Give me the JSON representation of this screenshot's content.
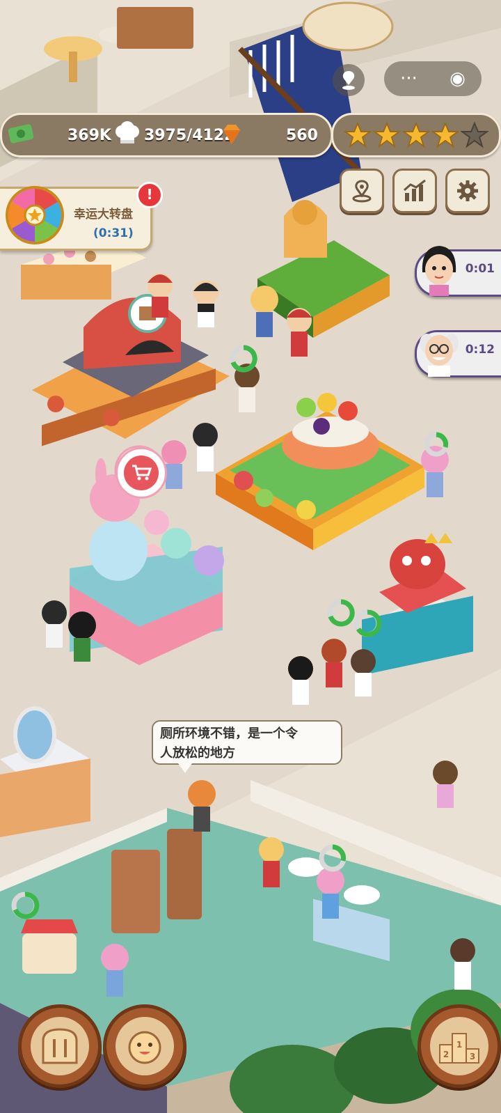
{
  "hud": {
    "cash_value": "369K",
    "chefs_value": "3975/4122",
    "gems_value": "560",
    "rating_stars_filled": 4,
    "rating_stars_total": 5
  },
  "lucky_wheel": {
    "title": "幸运大转盘",
    "timer": "(0:31)",
    "badge": "!"
  },
  "staff_timers": [
    {
      "icon": "receptionist-avatar-icon",
      "time": "0:01"
    },
    {
      "icon": "scientist-avatar-icon",
      "time": "0:12"
    }
  ],
  "speech_bubble": {
    "text_line1": "厕所环境不错，是一个令",
    "text_line2": "人放松的地方"
  },
  "bottom_buttons": {
    "menu_icon": "menu-bread-icon",
    "staff_icon": "chef-face-icon",
    "ranking_icon": "podium-icon"
  },
  "podium": {
    "ranks": [
      "2",
      "1",
      "3"
    ]
  },
  "colors": {
    "hud_bg": "#8a7a64",
    "star_gold": "#f5b82e",
    "star_empty": "#6b6256",
    "alert_red": "#e8373c",
    "timer_blue": "#2f6fae"
  }
}
